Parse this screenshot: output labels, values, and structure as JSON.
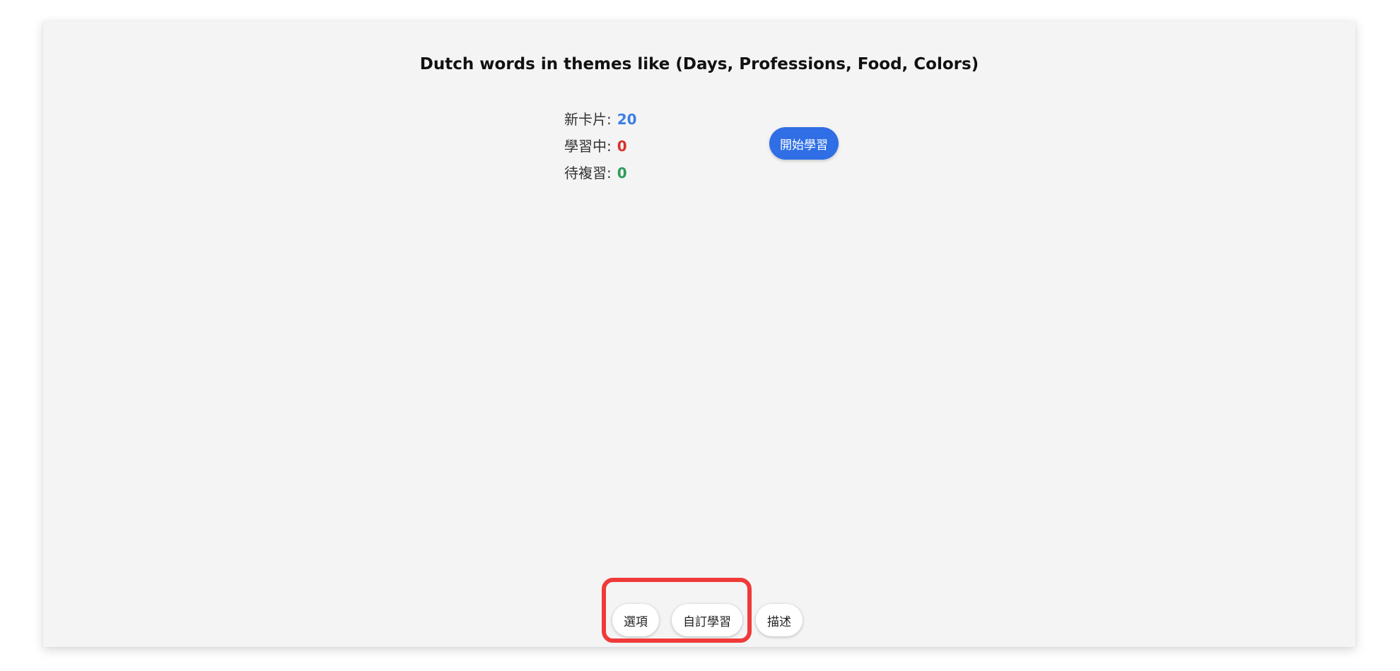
{
  "deck": {
    "title": "Dutch words in themes like (Days, Professions, Food, Colors)"
  },
  "stats": {
    "new_label": "新卡片:",
    "new_value": "20",
    "learning_label": "學習中:",
    "learning_value": "0",
    "review_label": "待複習:",
    "review_value": "0"
  },
  "actions": {
    "start_label": "開始學習"
  },
  "bottom_bar": {
    "options_label": "選項",
    "custom_study_label": "自訂學習",
    "describe_label": "描述"
  },
  "colors": {
    "new": "#3b7fe8",
    "learning": "#d9312b",
    "review": "#2e9d5a",
    "primary_button": "#2f6ee5",
    "highlight": "#f03a3a"
  }
}
